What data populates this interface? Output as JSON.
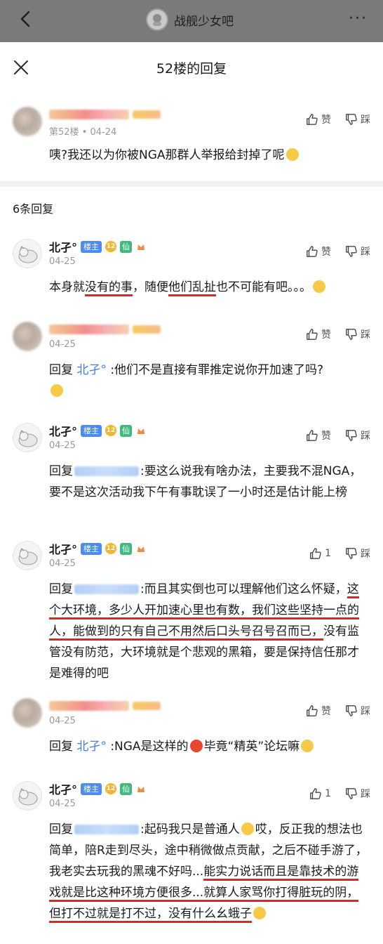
{
  "nav": {
    "forum_name": "战舰少女吧",
    "more": "···"
  },
  "sheet": {
    "title": "52楼的回复"
  },
  "op": {
    "floor": "第52楼",
    "dot": "•",
    "date": "04-24",
    "text": "咦?我还以为你被NGA那群人举报给封掉了呢",
    "like_label": "赞",
    "dislike_label": "踩"
  },
  "reply_count": "6条回复",
  "labels": {
    "louzhu": "楼主",
    "level": "12",
    "xian": "仙",
    "reply_prefix": "回复",
    "like": "赞",
    "dislike": "踩"
  },
  "replies": [
    {
      "name": "北孑°",
      "date": "04-25",
      "likes": "赞",
      "parts": [
        "本身就",
        "没有的事",
        "，随便",
        "他们乱扯",
        "也不可能有吧。。。"
      ]
    },
    {
      "date": "04-25",
      "likes": "赞",
      "to": "北孑°",
      "text": ":他们不是直接有罪推定说你开加速了吗?"
    },
    {
      "name": "北孑°",
      "date": "04-25",
      "likes": "赞",
      "text": ":要这么说我有啥办法，主要我不混NGA，要不是这次活动我下午有事耽误了一小时还是估计能上榜"
    },
    {
      "name": "北孑°",
      "date": "04-25",
      "likes": "1",
      "parts": [
        ":而且其实倒也可以理解他们这么怀疑，",
        "这个大环境，多少人开加速心里也有数，我们这些坚持一点的人，能做到的只有自己不用然后口头号召号召而已，",
        "没有监管没有防范，大环境就是个悲观的黑箱，要是保持信任那才是难得的吧"
      ]
    },
    {
      "date": "04-25",
      "likes": "赞",
      "to": "北孑°",
      "parts": [
        ":NGA是这样的",
        "毕竟“精英”论坛嘛"
      ]
    },
    {
      "name": "北孑°",
      "date": "04-25",
      "likes": "1",
      "parts": [
        ":起码我只是普通人",
        "哎，反正我的想法也简单，陪R走到尽头，途中稍微做点贡献，之后不碰手游了，我老实去玩我的黑魂不好吗...",
        "能实力说话而且是靠技术的游戏就是比这种环境方便很多...就算人家骂你打得脏玩的阴，但打不过就是打不过，没有什么幺蛾子"
      ]
    }
  ]
}
